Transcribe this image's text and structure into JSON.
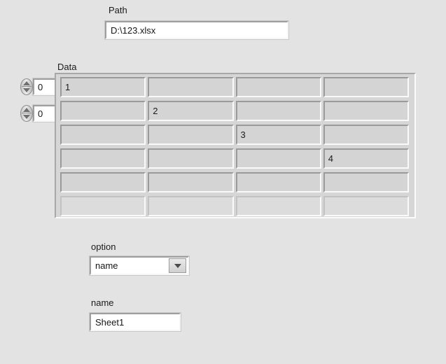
{
  "panel": {
    "background_color": "#e3e3e3"
  },
  "path_control": {
    "label": "Path",
    "value": "D:\\123.xlsx",
    "placeholder": ""
  },
  "data_array": {
    "label": "Data",
    "row_index": {
      "value": "0",
      "increment_icon": "spinner-up-icon",
      "decrement_icon": "spinner-down-icon"
    },
    "column_index": {
      "value": "0",
      "increment_icon": "spinner-up-icon",
      "decrement_icon": "spinner-down-icon"
    },
    "columns": 4,
    "visible_rows": 6,
    "rows": [
      [
        "1",
        "",
        "",
        ""
      ],
      [
        "",
        "2",
        "",
        ""
      ],
      [
        "",
        "",
        "3",
        ""
      ],
      [
        "",
        "",
        "",
        "4"
      ],
      [
        "",
        "",
        "",
        ""
      ],
      [
        "",
        "",
        "",
        ""
      ]
    ]
  },
  "option_ring": {
    "label": "option",
    "selected": "name",
    "dropdown_icon": "chevron-down-icon"
  },
  "name_control": {
    "label": "name",
    "value": "Sheet1",
    "placeholder": ""
  }
}
